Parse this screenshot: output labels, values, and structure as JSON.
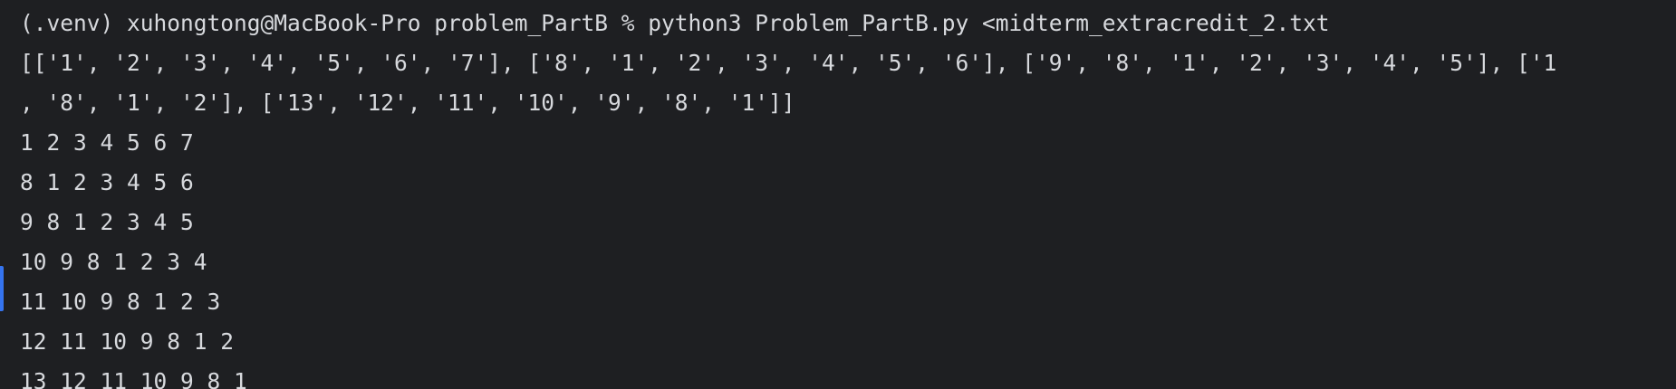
{
  "terminal": {
    "colors": {
      "background": "#1e1f22",
      "text": "#d7d9dd",
      "gutter_marker": "#3574f0"
    },
    "lines": [
      "(.venv) xuhongtong@MacBook-Pro problem_PartB % python3 Problem_PartB.py <midterm_extracredit_2.txt",
      "[['1', '2', '3', '4', '5', '6', '7'], ['8', '1', '2', '3', '4', '5', '6'], ['9', '8', '1', '2', '3', '4', '5'], ['1",
      ", '8', '1', '2'], ['13', '12', '11', '10', '9', '8', '1']]",
      "1 2 3 4 5 6 7",
      "8 1 2 3 4 5 6",
      "9 8 1 2 3 4 5",
      "10 9 8 1 2 3 4",
      "11 10 9 8 1 2 3",
      "12 11 10 9 8 1 2",
      "13 12 11 10 9 8 1"
    ]
  }
}
